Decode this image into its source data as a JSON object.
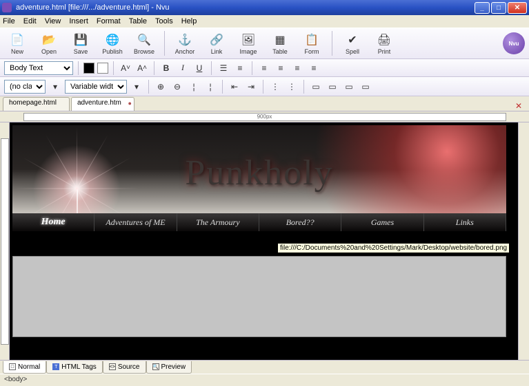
{
  "window": {
    "title": "adventure.html [file:///.../adventure.html] - Nvu"
  },
  "menu": [
    "File",
    "Edit",
    "View",
    "Insert",
    "Format",
    "Table",
    "Tools",
    "Help"
  ],
  "toolbar": [
    {
      "icon": "📄",
      "label": "New"
    },
    {
      "icon": "📂",
      "label": "Open"
    },
    {
      "icon": "💾",
      "label": "Save"
    },
    {
      "icon": "🌐",
      "label": "Publish"
    },
    {
      "icon": "🔍",
      "label": "Browse"
    },
    {
      "sep": true
    },
    {
      "icon": "⚓",
      "label": "Anchor"
    },
    {
      "icon": "🔗",
      "label": "Link"
    },
    {
      "icon": "🖼",
      "label": "Image"
    },
    {
      "icon": "▦",
      "label": "Table"
    },
    {
      "icon": "📋",
      "label": "Form"
    },
    {
      "sep": true
    },
    {
      "icon": "✔",
      "label": "Spell"
    },
    {
      "icon": "🖨",
      "label": "Print"
    }
  ],
  "format": {
    "paragraph": "Body Text",
    "case": "(no class)",
    "width": "Variable width"
  },
  "filetabs": [
    {
      "label": "homepage.html",
      "active": false
    },
    {
      "label": "adventure.htm",
      "active": true
    }
  ],
  "ruler": {
    "center": "900px"
  },
  "page": {
    "banner_title": "Punkholy",
    "nav": [
      {
        "label": "Home",
        "active": true
      },
      {
        "label": "Adventures of ME",
        "active": false
      },
      {
        "label": "The Armoury",
        "active": false
      },
      {
        "label": "Bored??",
        "active": false
      },
      {
        "label": "Games",
        "active": false
      },
      {
        "label": "Links",
        "active": false
      }
    ],
    "tooltip": "file:///C:/Documents%20and%20Settings/Mark/Desktop/website/bored.png"
  },
  "viewtabs": [
    {
      "label": "Normal",
      "active": true,
      "icon": "□"
    },
    {
      "label": "HTML Tags",
      "active": false,
      "icon": "T"
    },
    {
      "label": "Source",
      "active": false,
      "icon": "<>"
    },
    {
      "label": "Preview",
      "active": false,
      "icon": "🔍"
    }
  ],
  "status": "<body>"
}
